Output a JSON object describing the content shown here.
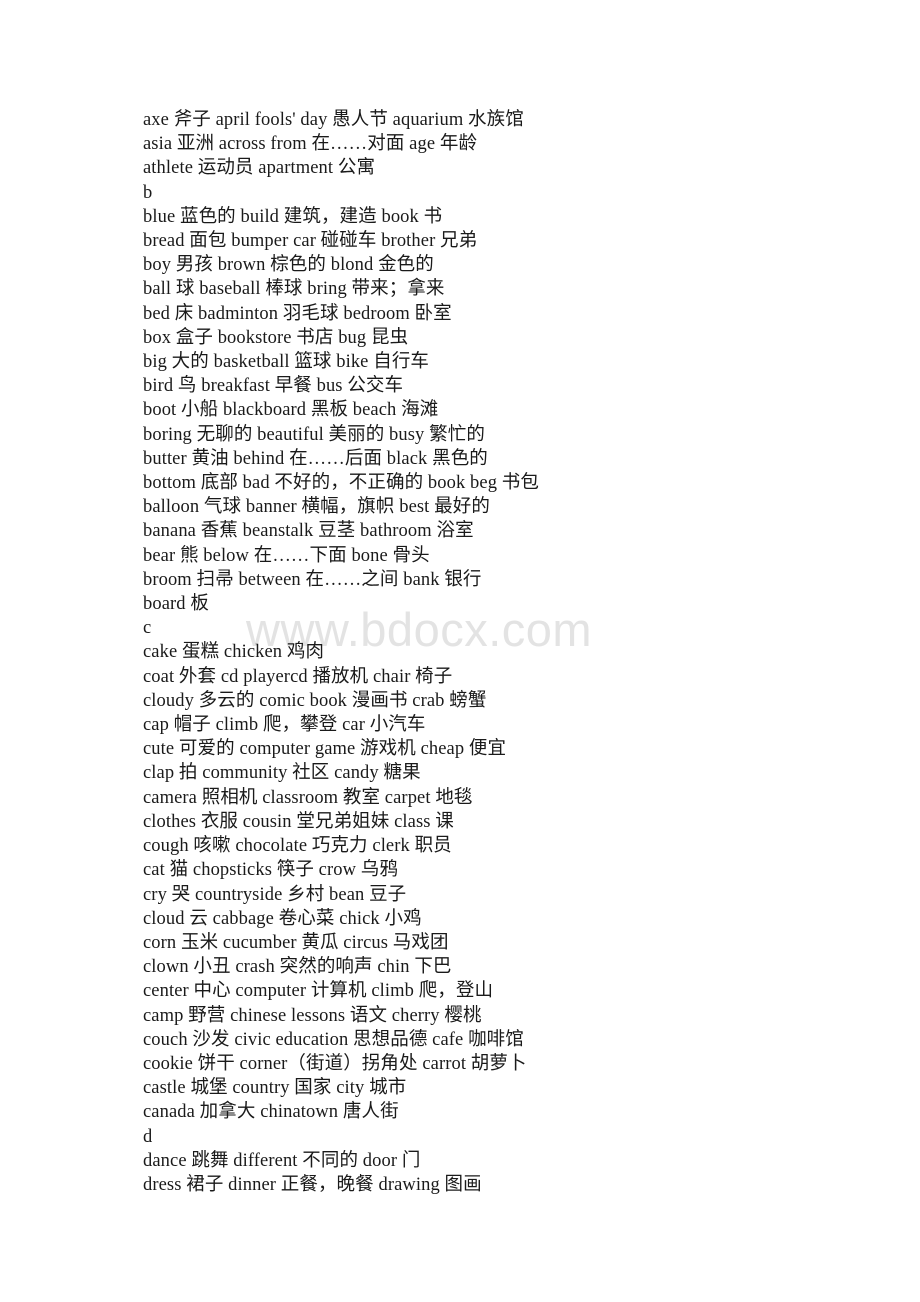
{
  "document": {
    "kind": "vocabulary-word-list",
    "background_color": "#ffffff",
    "text_color": "#1a1a1a",
    "watermark": {
      "text": "www.bdocx.com",
      "color": "#e3e3e3"
    },
    "lines": [
      {
        "id": "l1",
        "type": "entry",
        "text": "axe 斧子 april fools' day 愚人节 aquarium 水族馆"
      },
      {
        "id": "l2",
        "type": "entry",
        "text": "asia 亚洲 across from 在……对面 age 年龄"
      },
      {
        "id": "l3",
        "type": "entry",
        "text": "athlete 运动员 apartment 公寓"
      },
      {
        "id": "l4",
        "type": "heading",
        "text": "b"
      },
      {
        "id": "l5",
        "type": "entry",
        "text": "blue 蓝色的 build 建筑，建造 book 书"
      },
      {
        "id": "l6",
        "type": "entry",
        "text": "bread 面包 bumper car 碰碰车 brother 兄弟"
      },
      {
        "id": "l7",
        "type": "entry",
        "text": "boy 男孩 brown 棕色的 blond 金色的"
      },
      {
        "id": "l8",
        "type": "entry",
        "text": "ball 球 baseball 棒球 bring 带来；拿来"
      },
      {
        "id": "l9",
        "type": "entry",
        "text": "bed 床 badminton 羽毛球 bedroom 卧室"
      },
      {
        "id": "l10",
        "type": "entry",
        "text": "box 盒子 bookstore 书店 bug 昆虫"
      },
      {
        "id": "l11",
        "type": "entry",
        "text": "big 大的 basketball 篮球 bike 自行车"
      },
      {
        "id": "l12",
        "type": "entry",
        "text": "bird 鸟 breakfast 早餐 bus 公交车"
      },
      {
        "id": "l13",
        "type": "entry",
        "text": "boot 小船 blackboard 黑板 beach 海滩"
      },
      {
        "id": "l14",
        "type": "entry",
        "text": "boring 无聊的 beautiful 美丽的 busy 繁忙的"
      },
      {
        "id": "l15",
        "type": "entry",
        "text": "butter 黄油 behind 在……后面 black 黑色的"
      },
      {
        "id": "l16",
        "type": "entry",
        "text": "bottom 底部 bad 不好的，不正确的 book beg 书包"
      },
      {
        "id": "l17",
        "type": "entry",
        "text": "balloon 气球 banner 横幅，旗帜 best 最好的"
      },
      {
        "id": "l18",
        "type": "entry",
        "text": "banana 香蕉 beanstalk 豆茎 bathroom 浴室"
      },
      {
        "id": "l19",
        "type": "entry",
        "text": "bear 熊 below 在……下面 bone 骨头"
      },
      {
        "id": "l20",
        "type": "entry",
        "text": "broom 扫帚 between 在……之间 bank 银行"
      },
      {
        "id": "l21",
        "type": "entry",
        "text": "board 板"
      },
      {
        "id": "l22",
        "type": "heading",
        "text": "c"
      },
      {
        "id": "l23",
        "type": "entry",
        "text": "cake 蛋糕 chicken 鸡肉"
      },
      {
        "id": "l24",
        "type": "entry",
        "text": "coat 外套 cd playercd 播放机 chair 椅子"
      },
      {
        "id": "l25",
        "type": "entry",
        "text": "cloudy 多云的 comic book 漫画书 crab 螃蟹"
      },
      {
        "id": "l26",
        "type": "entry",
        "text": "cap 帽子 climb 爬，攀登 car 小汽车"
      },
      {
        "id": "l27",
        "type": "entry",
        "text": "cute 可爱的 computer game 游戏机 cheap 便宜"
      },
      {
        "id": "l28",
        "type": "entry",
        "text": "clap 拍 community 社区 candy 糖果"
      },
      {
        "id": "l29",
        "type": "entry",
        "text": "camera 照相机 classroom 教室 carpet 地毯"
      },
      {
        "id": "l30",
        "type": "entry",
        "text": "clothes 衣服 cousin 堂兄弟姐妹 class 课"
      },
      {
        "id": "l31",
        "type": "entry",
        "text": "cough 咳嗽 chocolate 巧克力 clerk 职员"
      },
      {
        "id": "l32",
        "type": "entry",
        "text": "cat 猫 chopsticks 筷子 crow 乌鸦"
      },
      {
        "id": "l33",
        "type": "entry",
        "text": "cry 哭 countryside 乡村 bean 豆子"
      },
      {
        "id": "l34",
        "type": "entry",
        "text": "cloud 云 cabbage 卷心菜 chick 小鸡"
      },
      {
        "id": "l35",
        "type": "entry",
        "text": "corn 玉米 cucumber 黄瓜 circus 马戏团"
      },
      {
        "id": "l36",
        "type": "entry",
        "text": "clown 小丑 crash 突然的响声 chin 下巴"
      },
      {
        "id": "l37",
        "type": "entry",
        "text": "center 中心 computer 计算机 climb 爬，登山"
      },
      {
        "id": "l38",
        "type": "entry",
        "text": "camp 野营 chinese lessons 语文 cherry 樱桃"
      },
      {
        "id": "l39",
        "type": "entry",
        "text": "couch 沙发 civic education 思想品德 cafe 咖啡馆"
      },
      {
        "id": "l40",
        "type": "entry",
        "text": "cookie 饼干 corner（街道）拐角处 carrot 胡萝卜"
      },
      {
        "id": "l41",
        "type": "entry",
        "text": "castle 城堡 country 国家 city 城市"
      },
      {
        "id": "l42",
        "type": "entry",
        "text": "canada 加拿大 chinatown 唐人街"
      },
      {
        "id": "l43",
        "type": "heading",
        "text": "d"
      },
      {
        "id": "l44",
        "type": "entry",
        "text": "dance 跳舞 different 不同的 door 门"
      },
      {
        "id": "l45",
        "type": "entry",
        "text": "dress 裙子 dinner 正餐，晚餐 drawing 图画"
      }
    ]
  }
}
